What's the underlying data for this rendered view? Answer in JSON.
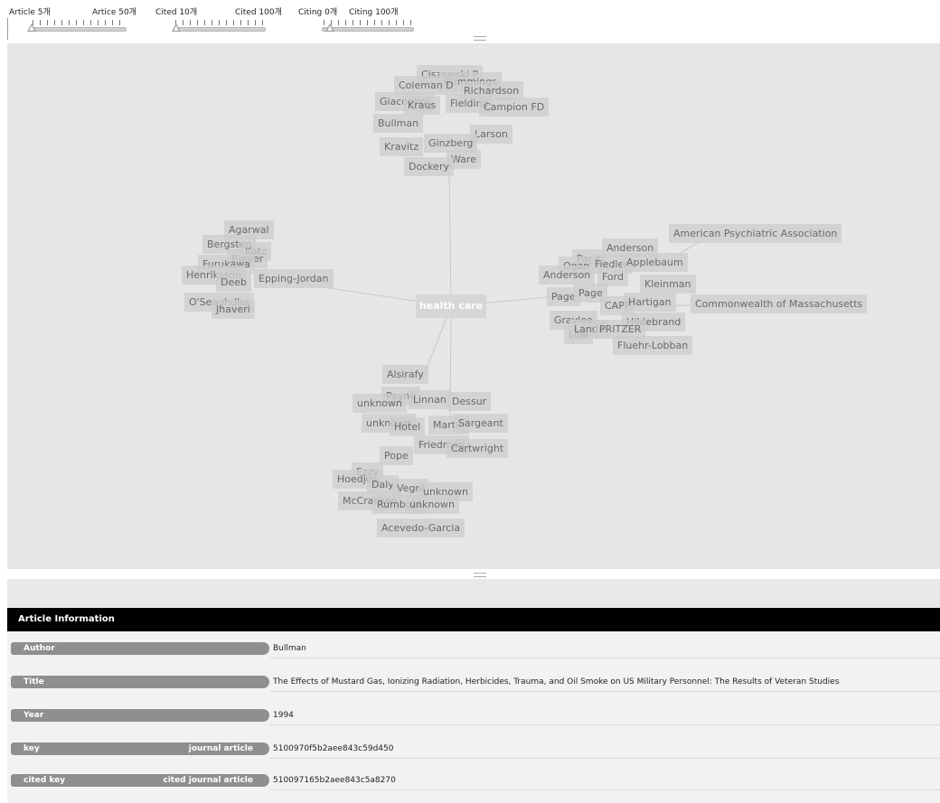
{
  "sliders": [
    {
      "min_label": "Article 5개",
      "max_label": "Artice 50개"
    },
    {
      "min_label": "Cited 10개",
      "max_label": "Cited 100개"
    },
    {
      "min_label": "Citing 0개",
      "max_label": "Citing 100개"
    }
  ],
  "graph": {
    "center": "health care",
    "clusters": {
      "top": [
        "Ciszewski P",
        "Cummings",
        "Coleman D",
        "Richardson",
        "Giacomini",
        "Kraus",
        "Fielding",
        "Campion FD",
        "Bullman",
        "Larson",
        "Kravitz",
        "Ginzberg",
        "Ware",
        "Dockery"
      ],
      "left": [
        "Agarwal",
        "Bergsten",
        "Katz",
        "Bleyer",
        "Furukawa",
        "Henriksson",
        "Deeb",
        "Epping-Jordan",
        "O'Seaghdha",
        "Jhaveri"
      ],
      "right": [
        "American Psychiatric Association",
        "Anderson",
        "Page",
        "Ogan",
        "Fiedler",
        "Applebaum",
        "Anderson",
        "Ford",
        "Kleinman",
        "Page",
        "Page",
        "CAPP",
        "Hartigan",
        "Commonwealth of Massachusetts",
        "Low",
        "Gravlee",
        "Hildebrand",
        "Landa",
        "PRITZER",
        "Fluehr-Lobban"
      ],
      "bottom": [
        "Alsirafy",
        "Payne",
        "unknown",
        "Linnan",
        "Dessur",
        "unknown",
        "Hotel",
        "Martin",
        "Sargeant",
        "Friedman",
        "Cartwright",
        "Pope",
        "Ezzy",
        "Hoedjes",
        "Daly",
        "Vegni",
        "unknown",
        "McCracken",
        "Rumbold",
        "unknown",
        "Acevedo-Garcia"
      ]
    }
  },
  "panel": {
    "header": "Article Information",
    "rows": [
      {
        "label": "Author",
        "tag": "",
        "value": "Bullman"
      },
      {
        "label": "Title",
        "tag": "",
        "value": "The Effects of Mustard Gas, Ionizing Radiation, Herbicides, Trauma, and Oil Smoke on US Military Personnel: The Results of Veteran Studies"
      },
      {
        "label": "Year",
        "tag": "",
        "value": "1994"
      },
      {
        "label": "key",
        "tag": "journal article",
        "value": "5100970f5b2aee843c59d450"
      },
      {
        "label": "cited key",
        "tag": "cited journal article",
        "value": "510097165b2aee843c5a8270"
      }
    ]
  }
}
